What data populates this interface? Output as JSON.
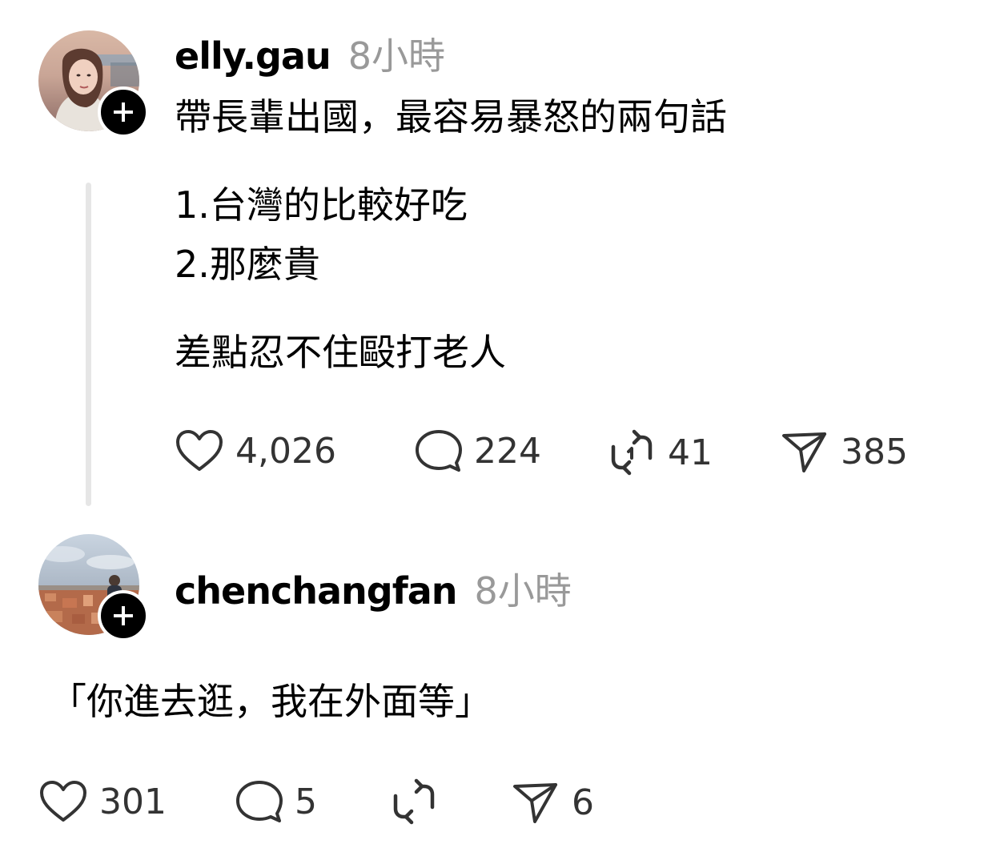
{
  "posts": [
    {
      "username": "elly.gau",
      "time": "8小時",
      "lines": [
        "帶長輩出國，最容易暴怒的兩句話",
        "1.台灣的比較好吃",
        "2.那麼貴",
        "差點忍不住毆打老人"
      ],
      "actions": {
        "likes": "4,026",
        "comments": "224",
        "reposts": "41",
        "shares": "385"
      },
      "avatar_icon": "profile-photo",
      "follow_icon": "plus-icon"
    },
    {
      "username": "chenchangfan",
      "time": "8小時",
      "lines": [
        "「你進去逛，我在外面等」"
      ],
      "actions": {
        "likes": "301",
        "comments": "5",
        "reposts": "",
        "shares": "6"
      },
      "avatar_icon": "profile-photo",
      "follow_icon": "plus-icon"
    }
  ],
  "colors": {
    "text": "#000000",
    "muted": "#999999",
    "icon": "#333333",
    "thread_line": "#e6e6e6"
  }
}
